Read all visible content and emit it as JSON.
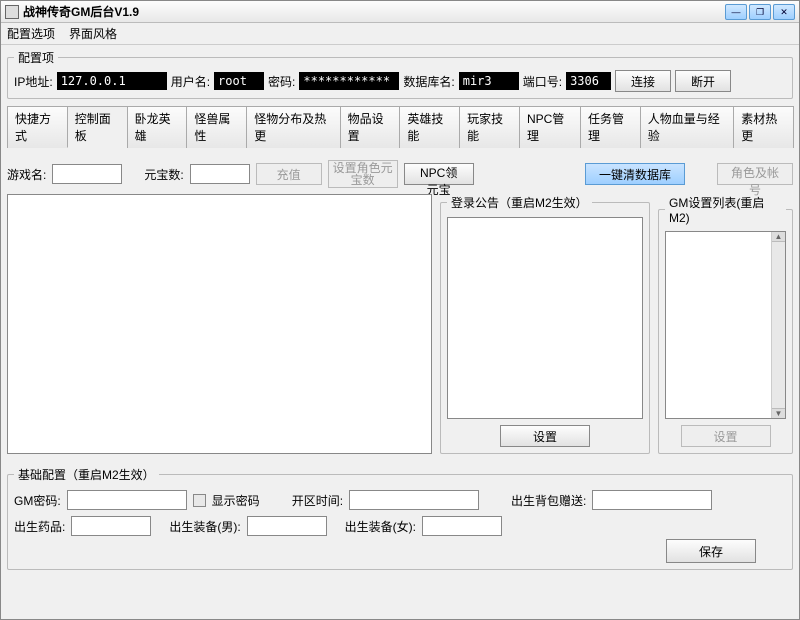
{
  "title": "战神传奇GM后台V1.9",
  "menu": {
    "opt1": "配置选项",
    "opt2": "界面风格"
  },
  "winctrl": {
    "min": "—",
    "max": "❐",
    "close": "✕"
  },
  "config": {
    "legend": "配置项",
    "ip_label": "IP地址:",
    "ip_value": "127.0.0.1",
    "user_label": "用户名:",
    "user_value": "root",
    "pass_label": "密码:",
    "pass_value": "************",
    "db_label": "数据库名:",
    "db_value": "mir3",
    "port_label": "端口号:",
    "port_value": "3306",
    "connect": "连接",
    "disconnect": "断开"
  },
  "tabs": [
    "快捷方式",
    "控制面板",
    "卧龙英雄",
    "怪兽属性",
    "怪物分布及热更",
    "物品设置",
    "英雄技能",
    "玩家技能",
    "NPC管理",
    "任务管理",
    "人物血量与经验",
    "素材热更"
  ],
  "active_tab": 1,
  "ctrl": {
    "game_label": "游戏名:",
    "yuanbao_label": "元宝数:",
    "recharge": "充值",
    "set_role_yb": "设置角色元宝数",
    "npc_yb": "NPC领元宝",
    "clear_db": "一键清数据库",
    "role_account": "角色及帐号",
    "login_notice_legend": "登录公告（重启M2生效）",
    "gm_list_legend": "GM设置列表(重启M2)",
    "set_button": "设置"
  },
  "base": {
    "legend": "基础配置（重启M2生效）",
    "gm_pass_label": "GM密码:",
    "show_pass": "显示密码",
    "open_time_label": "开区时间:",
    "birth_bag_label": "出生背包赠送:",
    "birth_drug_label": "出生药品:",
    "birth_equip_m_label": "出生装备(男):",
    "birth_equip_f_label": "出生装备(女):",
    "save": "保存"
  }
}
